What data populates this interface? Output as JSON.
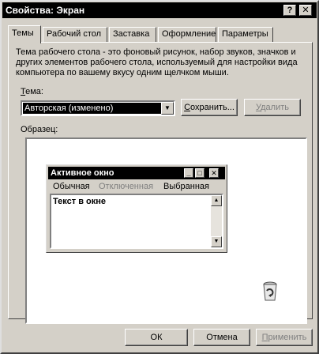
{
  "window": {
    "title": "Свойства: Экран",
    "help_glyph": "?",
    "close_glyph": "✕"
  },
  "tabs": [
    {
      "label": "Темы",
      "active": true
    },
    {
      "label": "Рабочий стол"
    },
    {
      "label": "Заставка"
    },
    {
      "label": "Оформление"
    },
    {
      "label": "Параметры"
    }
  ],
  "themes": {
    "description": "Тема рабочего стола - это фоновый рисунок, набор звуков, значков и других элементов рабочего стола, используемый для настройки вида компьютера по вашему вкусу одним щелчком мыши.",
    "theme_label_access": "Т",
    "theme_label_rest": "ема:",
    "selected_theme": "Авторская (изменено)",
    "save_button": "Сохранить...",
    "save_button_access": "С",
    "save_button_rest": "охранить...",
    "delete_button": "Удалить",
    "delete_button_access": "У",
    "delete_button_rest": "далить",
    "sample_label": "Образец:"
  },
  "preview": {
    "window_title": "Активное окно",
    "menu_normal": "Обычная",
    "menu_disabled": "Отключенная",
    "menu_selected": "Выбранная",
    "body_text": "Текст в окне",
    "recycle_bin_icon": "recycle-bin-icon"
  },
  "footer": {
    "ok": "ОК",
    "cancel": "Отмена",
    "apply_access": "П",
    "apply_rest": "рименить"
  },
  "colors": {
    "face": "#d4d0c8",
    "titlebar": "#000000",
    "disabled_text": "#808080"
  }
}
